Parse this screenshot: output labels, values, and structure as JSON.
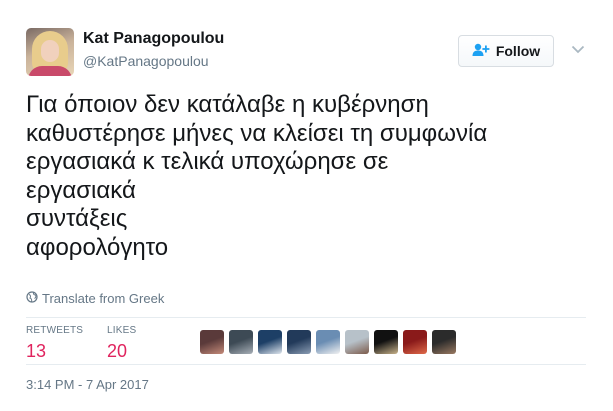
{
  "author": {
    "name": "Kat Panagopoulou",
    "handle": "@KatPanagopoulou"
  },
  "follow_label": "Follow",
  "tweet_lines": [
    "Για όποιον δεν κατάλαβε η κυβέρνηση",
    "καθυστέρησε μήνες να κλείσει τη συμφωνία",
    "εργασιακά κ τελικά υποχώρησε σε",
    "εργασιακά",
    "συντάξεις",
    "αφορολόγητο"
  ],
  "translate_label": "Translate from Greek",
  "stats": {
    "retweets_label": "RETWEETS",
    "retweets_count": "13",
    "likes_label": "LIKES",
    "likes_count": "20"
  },
  "liker_avatars": [
    {
      "name": "liker-avatar-1",
      "colors": [
        "#5a3a3a",
        "#c58b7a"
      ]
    },
    {
      "name": "liker-avatar-2",
      "colors": [
        "#3d4a55",
        "#a8b0b8"
      ]
    },
    {
      "name": "liker-avatar-3",
      "colors": [
        "#1d3f66",
        "#dfe6ee"
      ]
    },
    {
      "name": "liker-avatar-4",
      "colors": [
        "#223a5a",
        "#8b9db4"
      ]
    },
    {
      "name": "liker-avatar-5",
      "colors": [
        "#6a8db3",
        "#f2f2f2"
      ]
    },
    {
      "name": "liker-avatar-6",
      "colors": [
        "#b7c1c9",
        "#7c5a4a"
      ]
    },
    {
      "name": "liker-avatar-7",
      "colors": [
        "#111111",
        "#c9b38a"
      ]
    },
    {
      "name": "liker-avatar-8",
      "colors": [
        "#8a1a1a",
        "#e06a4a"
      ]
    },
    {
      "name": "liker-avatar-9",
      "colors": [
        "#2b2b2b",
        "#9a7a62"
      ]
    }
  ],
  "timestamp": "3:14 PM - 7 Apr 2017",
  "colors": {
    "likes_accent": "#e0245e",
    "follow_icon": "#1da1f2",
    "muted_text": "#657786"
  }
}
